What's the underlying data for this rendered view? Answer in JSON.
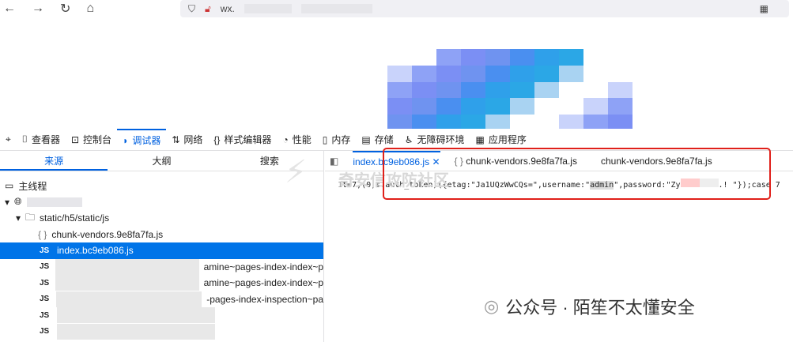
{
  "browser": {
    "url_prefix": "wx.",
    "icons": [
      "back-icon",
      "forward-icon",
      "reload-icon",
      "home-icon",
      "shield-icon",
      "no-lock-icon",
      "qr-icon"
    ]
  },
  "devtools": {
    "tools": [
      {
        "label": "查看器",
        "icon": "inspector-icon"
      },
      {
        "label": "控制台",
        "icon": "console-icon"
      },
      {
        "label": "调试器",
        "icon": "debugger-icon",
        "selected": true
      },
      {
        "label": "网络",
        "icon": "network-icon"
      },
      {
        "label": "样式编辑器",
        "icon": "style-icon"
      },
      {
        "label": "性能",
        "icon": "performance-icon"
      },
      {
        "label": "内存",
        "icon": "memory-icon"
      },
      {
        "label": "存储",
        "icon": "storage-icon"
      },
      {
        "label": "无障碍环境",
        "icon": "accessibility-icon"
      },
      {
        "label": "应用程序",
        "icon": "application-icon"
      }
    ],
    "panel_tabs": [
      "来源",
      "大纲",
      "搜索"
    ],
    "tree": {
      "main_thread": "主线程",
      "folder": "static/h5/static/js",
      "chunk": "chunk-vendors.9e8fa7fa.js",
      "selected": "index.bc9eb086.js",
      "partial_rows": [
        "amine~pages-index-index~p",
        "amine~pages-index-index~p",
        "-pages-index-inspection~pa",
        "",
        ""
      ]
    },
    "source_tabs": [
      {
        "label": "index.bc9eb086.js",
        "selected": true
      },
      {
        "label": "chunk-vendors.9e8fa7fa.js"
      },
      {
        "label": "chunk-vendors.9e8fa7fa.js"
      }
    ],
    "code": {
      "line_no": "1",
      "before": "t=7,(0,s.auth_token)({etag:\"Ja1UQzWwCQs=\",username:\"",
      "username": "admin",
      "mid": "\",password:\"Zy",
      "after": ".! \"});case 7"
    }
  },
  "watermark": {
    "site": "奇安信攻防社区",
    "account": "公众号 · 陌笙不太懂安全"
  }
}
